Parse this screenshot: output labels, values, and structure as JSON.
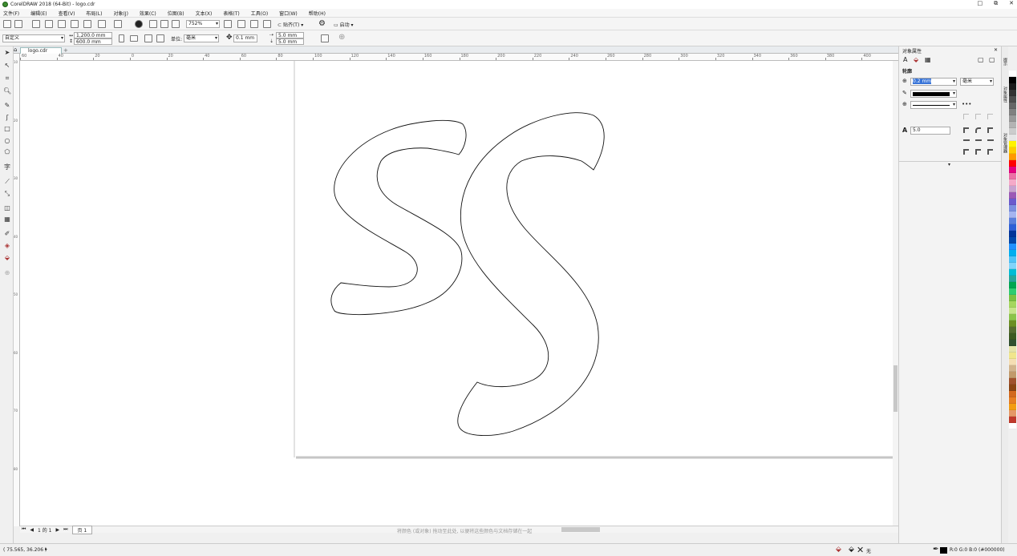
{
  "window": {
    "title": "CorelDRAW 2018 (64-Bit) - logo.cdr",
    "controls": [
      "□",
      "⧉",
      "✕"
    ]
  },
  "menu": [
    "文件(F)",
    "编辑(E)",
    "查看(V)",
    "布局(L)",
    "对象(J)",
    "效果(C)",
    "位图(B)",
    "文本(X)",
    "表格(T)",
    "工具(O)",
    "窗口(W)",
    "帮助(H)"
  ],
  "toolbar": {
    "zoom": "752%",
    "snap_label": "贴齐(T)",
    "launch_label": "启动"
  },
  "propbar": {
    "preset": "自定义",
    "width": "1,200.0 mm",
    "height": "600.0 mm",
    "units_label": "单位:",
    "units": "毫米",
    "nudge": "0.1 mm",
    "dup_x": "5.0 mm",
    "dup_y": "5.0 mm"
  },
  "document": {
    "tab_name": "logo.cdr",
    "tab_add": "+"
  },
  "ruler": {
    "h_labels": [
      "60",
      "40",
      "20",
      "0",
      "20",
      "40",
      "60",
      "80",
      "100",
      "120",
      "140",
      "160",
      "180",
      "200",
      "220",
      "240",
      "260",
      "280",
      "300",
      "320",
      "340",
      "360",
      "380",
      "400"
    ],
    "v_labels": [
      "10",
      "20",
      "30",
      "40",
      "50",
      "60",
      "70",
      "80"
    ]
  },
  "pagenav": {
    "first": "⏮",
    "prev": "◀",
    "page_count": "1 的 1",
    "next": "▶",
    "last": "⏭",
    "page_tab": "页 1"
  },
  "hint_text": "将颜色 (或对象) 拖动至此处, 以便将这些颜色与文档存储在一起",
  "status": {
    "coords": "( 75.565, 36.206 )",
    "fill_none": "无",
    "color_info": "R:0 G:0 B:0 (#000000)"
  },
  "docker": {
    "title": "对象属性",
    "section": "轮廓",
    "outline_width": "0.2 mm",
    "outline_units": "毫米",
    "miter_label": "5.0"
  },
  "sidetabs": [
    "提示",
    "对象属性",
    "对象管理器"
  ],
  "palette": [
    "#ffffff",
    "#000000",
    "#1a1a1a",
    "#333333",
    "#4d4d4d",
    "#666666",
    "#808080",
    "#999999",
    "#b3b3b3",
    "#cccccc",
    "#e6e6e6",
    "#fff200",
    "#ffcc00",
    "#ff9900",
    "#ff0000",
    "#e4007f",
    "#ec6fa6",
    "#f5a9c8",
    "#c8a2d0",
    "#9b59b6",
    "#6a5acd",
    "#7b8fe0",
    "#a5b4f0",
    "#5b7fdc",
    "#2e5fd6",
    "#003399",
    "#0047ab",
    "#1e90ff",
    "#00aeef",
    "#4fc3f7",
    "#81d4fa",
    "#00bcd4",
    "#26a69a",
    "#00a650",
    "#2ecc71",
    "#7bc043",
    "#a5d65f",
    "#c6e48b",
    "#8bc34a",
    "#6b8e23",
    "#556b2f",
    "#3d5a1f",
    "#2f4f2f",
    "#e5e4a8",
    "#f0e68c",
    "#f5deb3",
    "#d2b48c",
    "#c19a6b",
    "#a0522d",
    "#8b4513",
    "#d2691e",
    "#e67e22",
    "#f39c12",
    "#e59866",
    "#c0392b",
    "#ffffff"
  ]
}
